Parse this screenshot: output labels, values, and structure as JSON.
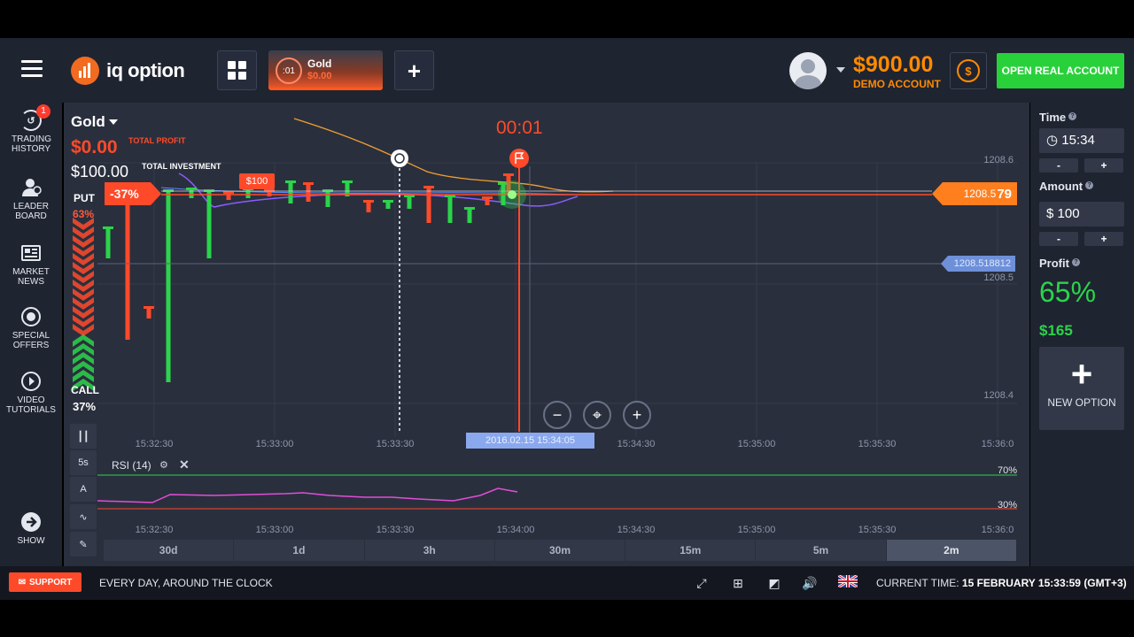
{
  "header": {
    "logo_text": "iq option",
    "asset_tab": {
      "timer": ":01",
      "name": "Gold",
      "value": "$0.00"
    },
    "balance": "$900.00",
    "account_type": "DEMO ACCOUNT",
    "open_real_label": "OPEN REAL ACCOUNT",
    "colors": {
      "accent": "#ff8a00",
      "brand": "#f26b21",
      "cta": "#28d13a"
    }
  },
  "sidebar": {
    "items": [
      {
        "label": "TRADING HISTORY",
        "icon": "history-icon",
        "badge": "1"
      },
      {
        "label": "LEADER BOARD",
        "icon": "leaderboard-icon"
      },
      {
        "label": "MARKET NEWS",
        "icon": "news-icon"
      },
      {
        "label": "SPECIAL OFFERS",
        "icon": "offers-icon"
      },
      {
        "label": "VIDEO TUTORIALS",
        "icon": "play-icon"
      }
    ],
    "show_label": "SHOW"
  },
  "chart": {
    "asset": "Gold",
    "total_profit": "$0.00",
    "total_profit_label": "TOTAL PROFIT",
    "total_investment": "$100.00",
    "total_investment_label": "TOTAL INVESTMENT",
    "put_label": "PUT",
    "put_pct": "63%",
    "call_label": "CALL",
    "call_pct": "37%",
    "timer": "00:01",
    "position_pct": "-37%",
    "bet_tag": "$100",
    "price_tag_main": "1208.5",
    "price_tag_tail": "79",
    "cursor_price": "1208.518812",
    "cursor_time": "2016.02.15 15:34:05",
    "price_labels": [
      "1208.6",
      "1208.5",
      "1208.4"
    ],
    "time_labels": [
      "15:32:30",
      "15:33:00",
      "15:33:30",
      "15:34:00",
      "15:34:30",
      "15:35:00",
      "15:35:30",
      "15:36:0"
    ],
    "rsi": {
      "label": "RSI (14)",
      "upper": "70%",
      "lower": "30%"
    },
    "timeframe_btn": "5s",
    "periods": [
      "30d",
      "1d",
      "3h",
      "30m",
      "15m",
      "5m",
      "2m"
    ],
    "active_period": "2m"
  },
  "chart_data": {
    "type": "line",
    "title": "",
    "x": [
      "15:32:30",
      "15:33:00",
      "15:33:30",
      "15:34:00",
      "15:34:30",
      "15:35:00",
      "15:35:30",
      "15:36:0"
    ],
    "y_ticks": [
      1208.4,
      1208.5,
      1208.6
    ],
    "current_price": 1208.579,
    "rsi_levels": [
      30,
      70
    ]
  },
  "right_panel": {
    "time_label": "Time",
    "time_value": "15:34",
    "amount_label": "Amount",
    "amount_value": "$ 100",
    "profit_label": "Profit",
    "profit_pct": "65%",
    "profit_value": "$165",
    "new_option_label": "NEW OPTION",
    "minus": "-",
    "plus": "+"
  },
  "footer": {
    "support_label": "SUPPORT",
    "tagline": "EVERY DAY, AROUND THE CLOCK",
    "current_time_label": "CURRENT TIME:",
    "current_time_value": "15 FEBRUARY 15:33:59",
    "timezone": "(GMT+3)"
  }
}
